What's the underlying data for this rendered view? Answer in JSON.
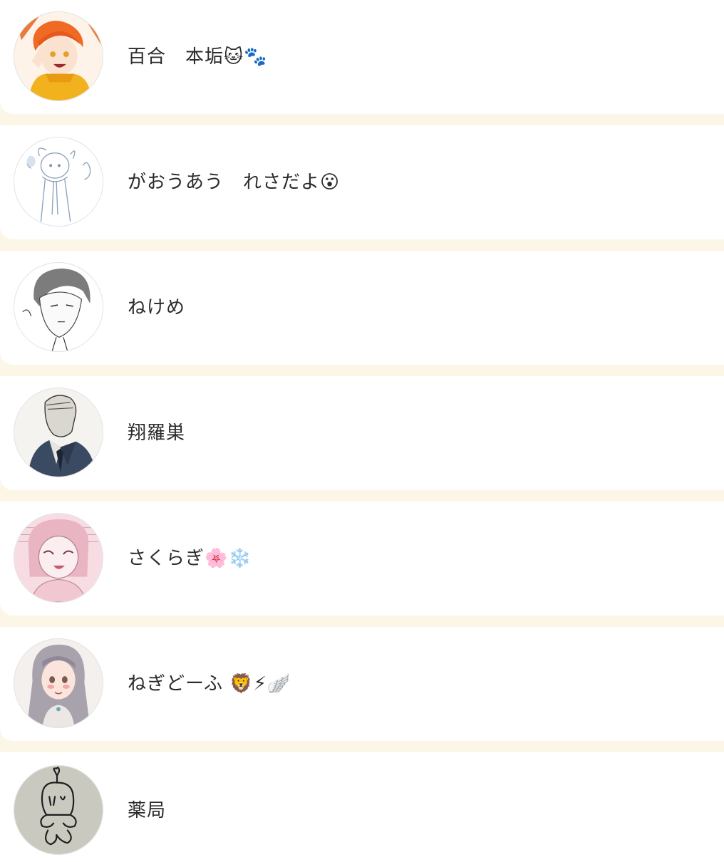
{
  "users": [
    {
      "name": "百合　本垢🐱🐾",
      "avatar": "orange-hair-character-avatar-icon"
    },
    {
      "name": "がおうあう　れさだよ😮",
      "avatar": "sketch-girl-avatar-icon"
    },
    {
      "name": "ねけめ",
      "avatar": "gray-hair-boy-avatar-icon"
    },
    {
      "name": "翔羅巣",
      "avatar": "suited-man-sketch-avatar-icon"
    },
    {
      "name": "さくらぎ🌸❄️",
      "avatar": "pink-manga-girl-avatar-icon"
    },
    {
      "name": "ねぎどーふ 🦁⚡🪽",
      "avatar": "long-hair-girl-avatar-icon"
    },
    {
      "name": "薬局",
      "avatar": "doodle-creature-avatar-icon"
    }
  ],
  "colors": {
    "background": "#fbf6e6",
    "card": "#ffffff",
    "text": "#2b2b2b"
  }
}
